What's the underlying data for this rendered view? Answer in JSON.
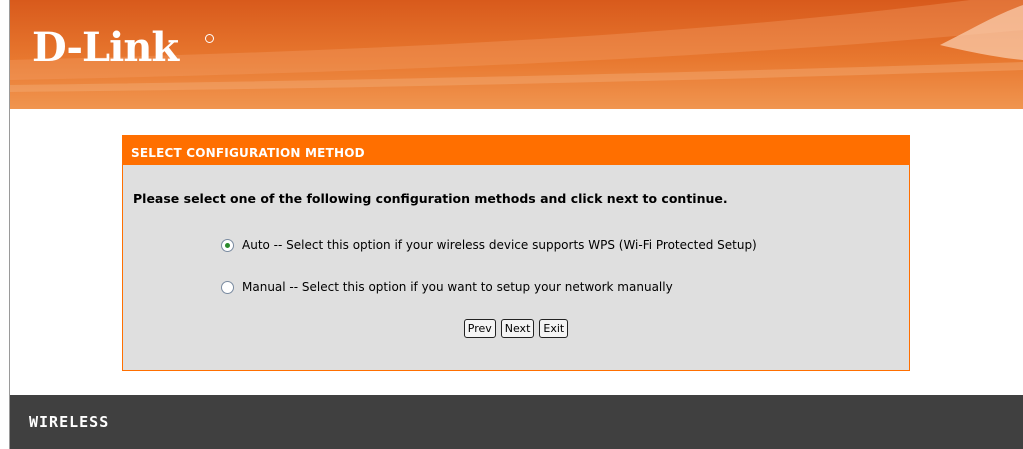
{
  "brand": {
    "logo_text": "D-Link",
    "header_color": "#e8782f",
    "accent_color": "#ff6f00",
    "footer_color": "#404040"
  },
  "panel": {
    "title": "SELECT CONFIGURATION METHOD",
    "intro": "Please select one of the following configuration methods and click next to continue.",
    "options": [
      {
        "label": "Auto -- Select this option if your wireless device supports WPS (Wi-Fi Protected Setup)",
        "selected": true
      },
      {
        "label": "Manual -- Select this option if you want to setup your network manually",
        "selected": false
      }
    ],
    "buttons": {
      "prev": "Prev",
      "next": "Next",
      "exit": "Exit"
    }
  },
  "footer": {
    "label": "WIRELESS"
  }
}
